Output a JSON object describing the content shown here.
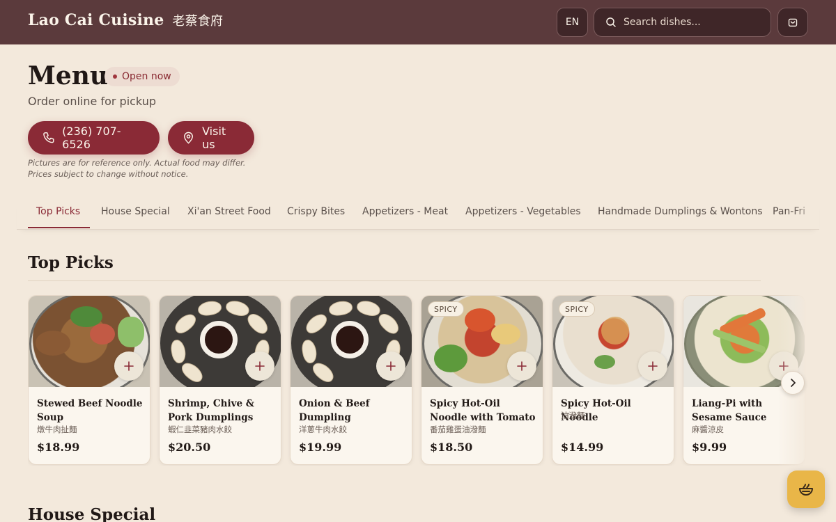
{
  "header": {
    "brand_name": "Lao Cai Cuisine",
    "brand_name_zh": "老蔡食府",
    "language": "EN",
    "search_placeholder": "Search dishes...",
    "cart_icon": "shopping-bag-icon"
  },
  "hero": {
    "title": "Menu",
    "status": "Open now",
    "subtitle": "Order online for pickup",
    "phone_label": "(236) 707-6526",
    "visit_label": "Visit us",
    "disclaimer_line1": "Pictures are for reference only. Actual food may differ.",
    "disclaimer_line2": "Prices subject to change without notice."
  },
  "tabs": [
    "Top Picks",
    "House Special",
    "Xi'an Street Food",
    "Crispy Bites",
    "Appetizers - Meat",
    "Appetizers - Vegetables",
    "Handmade Dumplings & Wontons",
    "Pan-Fri"
  ],
  "active_tab": "Top Picks",
  "sections": {
    "top_picks": "Top Picks",
    "house_special": "House Special"
  },
  "top_picks": [
    {
      "name": "Stewed Beef Noodle Soup",
      "name_zh": "燉牛肉扯麵",
      "price": "$18.99",
      "tag": ""
    },
    {
      "name": "Shrimp, Chive & Pork Dumplings",
      "name_zh": "蝦仁韭菜豬肉水餃",
      "price": "$20.50",
      "tag": ""
    },
    {
      "name": "Onion & Beef Dumpling",
      "name_zh": "洋蔥牛肉水餃",
      "price": "$19.99",
      "tag": ""
    },
    {
      "name": "Spicy Hot-Oil Noodle with Tomato & Egg...",
      "name_zh": "番茄雞蛋油潑麵",
      "price": "$18.50",
      "tag": "SPICY"
    },
    {
      "name": "Spicy Hot-Oil Noodle",
      "name_zh": "油潑麵",
      "price": "$14.99",
      "tag": "SPICY"
    },
    {
      "name": "Liang-Pi with Sesame Sauce",
      "name_zh": "麻醬涼皮",
      "price": "$9.99",
      "tag": ""
    }
  ],
  "colors": {
    "header_bg": "#5b3a3c",
    "page_bg": "#f3e9dc",
    "accent": "#8a2a36",
    "helper_button": "#e9b648"
  }
}
